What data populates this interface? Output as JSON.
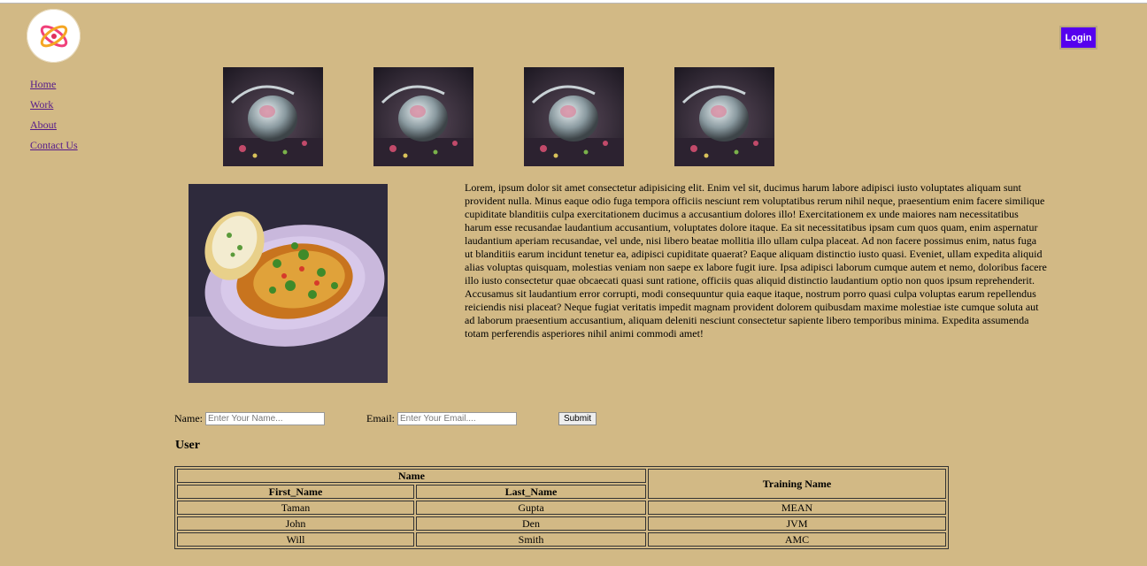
{
  "header": {
    "login_label": "Login"
  },
  "nav": [
    "Home",
    "Work",
    "About",
    "Contact Us"
  ],
  "content": {
    "paragraph": "Lorem, ipsum dolor sit amet consectetur adipisicing elit. Enim vel sit, ducimus harum labore adipisci iusto voluptates aliquam sunt provident nulla. Minus eaque odio fuga tempora officiis nesciunt rem voluptatibus rerum nihil neque, praesentium enim facere similique cupiditate blanditiis culpa exercitationem ducimus a accusantium dolores illo! Exercitationem ex unde maiores nam necessitatibus harum esse recusandae laudantium accusantium, voluptates dolore itaque. Ea sit necessitatibus ipsam cum quos quam, enim aspernatur laudantium aperiam recusandae, vel unde, nisi libero beatae mollitia illo ullam culpa placeat. Ad non facere possimus enim, natus fuga ut blanditiis earum incidunt tenetur ea, adipisci cupiditate quaerat? Eaque aliquam distinctio iusto quasi. Eveniet, ullam expedita aliquid alias voluptas quisquam, molestias veniam non saepe ex labore fugit iure. Ipsa adipisci laborum cumque autem et nemo, doloribus facere illo iusto consectetur quae obcaecati quasi sunt ratione, officiis quas aliquid distinctio laudantium optio non quos ipsum reprehenderit. Accusamus sit laudantium error corrupti, modi consequuntur quia eaque itaque, nostrum porro quasi culpa voluptas earum repellendus reiciendis nisi placeat? Neque fugiat veritatis impedit magnam provident dolorem quibusdam maxime molestiae iste cumque soluta aut ad laborum praesentium accusantium, aliquam deleniti nesciunt consectetur sapiente libero temporibus minima. Expedita assumenda totam perferendis asperiores nihil animi commodi amet!"
  },
  "form": {
    "name_label": "Name:",
    "name_placeholder": "Enter Your Name...",
    "email_label": "Email:",
    "email_placeholder": "Enter Your Email....",
    "submit_label": "Submit"
  },
  "table": {
    "heading": "User",
    "group_header": "Name",
    "col_first": "First_Name",
    "col_last": "Last_Name",
    "col_training": "Training Name",
    "rows": [
      {
        "first": "Taman",
        "last": "Gupta",
        "training": "MEAN"
      },
      {
        "first": "John",
        "last": "Den",
        "training": "JVM"
      },
      {
        "first": "Will",
        "last": "Smith",
        "training": "AMC"
      }
    ]
  },
  "colors": {
    "background": "#d2b985",
    "login_button": "#5500ee",
    "link": "#551a8b"
  }
}
